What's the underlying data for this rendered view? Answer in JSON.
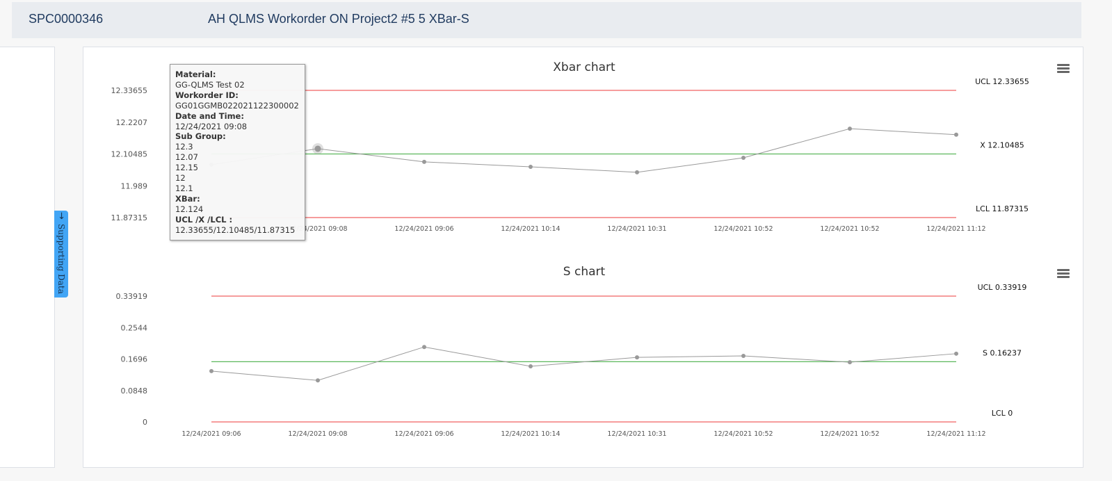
{
  "header": {
    "id": "SPC0000346",
    "title": "AH QLMS Workorder ON Project2 #5 5 XBar-S"
  },
  "side_tab": {
    "arrow": "→",
    "label": "Supporting Data"
  },
  "tooltip": {
    "material_label": "Material:",
    "material": "GG-QLMS Test 02",
    "workorder_label": "Workorder ID:",
    "workorder": "GG01GGMB022021122300002",
    "datetime_label": "Date and Time:",
    "datetime": "12/24/2021 09:08",
    "subgroup_label": "Sub Group:",
    "subgroup": [
      "12.3",
      "12.07",
      "12.15",
      "12",
      "12.1"
    ],
    "xbar_label": "XBar:",
    "xbar": "12.124",
    "limits_label": "UCL /X /LCL :",
    "limits": "12.33655/12.10485/11.87315"
  },
  "chart_data": [
    {
      "type": "line",
      "title": "Xbar chart",
      "categories": [
        "12/24/2021 09:06",
        "12/24/2021 09:08",
        "12/24/2021 09:06",
        "12/24/2021 10:14",
        "12/24/2021 10:31",
        "12/24/2021 10:52",
        "12/24/2021 10:52",
        "12/24/2021 11:12"
      ],
      "values": [
        12.066,
        12.124,
        12.076,
        12.058,
        12.038,
        12.091,
        12.197,
        12.175
      ],
      "yticks": [
        "12.33655",
        "12.2207",
        "12.10485",
        "11.989",
        "11.87315"
      ],
      "ylim": [
        11.87315,
        12.33655
      ],
      "ucl": 12.33655,
      "center": 12.10485,
      "lcl": 11.87315,
      "ucl_label": "UCL 12.33655",
      "center_label": "X 12.10485",
      "lcl_label": "LCL 11.87315",
      "highlight_index": 1,
      "colors": {
        "limit": "#f06060",
        "center": "#5cb85c",
        "series": "#999999"
      }
    },
    {
      "type": "line",
      "title": "S chart",
      "categories": [
        "12/24/2021 09:06",
        "12/24/2021 09:08",
        "12/24/2021 09:06",
        "12/24/2021 10:14",
        "12/24/2021 10:31",
        "12/24/2021 10:52",
        "12/24/2021 10:52",
        "12/24/2021 11:12"
      ],
      "values": [
        0.137,
        0.112,
        0.202,
        0.15,
        0.174,
        0.178,
        0.161,
        0.184
      ],
      "yticks": [
        "0.33919",
        "0.2544",
        "0.1696",
        "0.0848",
        "0"
      ],
      "ylim": [
        0,
        0.33919
      ],
      "ucl": 0.33919,
      "center": 0.16237,
      "lcl": 0,
      "ucl_label": "UCL 0.33919",
      "center_label": "S 0.16237",
      "lcl_label": "LCL 0",
      "colors": {
        "limit": "#f06060",
        "center": "#5cb85c",
        "series": "#999999"
      }
    }
  ]
}
